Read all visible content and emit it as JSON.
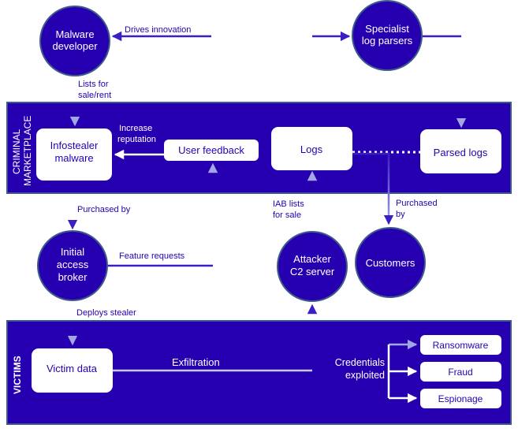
{
  "colors": {
    "primary": "#2600b0",
    "border": "#3f5a8a",
    "arrow_dark": "#3a1fc4",
    "arrow_light": "#a3a6e6",
    "box_fill": "#ffffff"
  },
  "regions": {
    "marketplace": {
      "label_line1": "CRIMINAL",
      "label_line2": "MARKETPLACE"
    },
    "victims": {
      "label": "VICTIMS"
    }
  },
  "actors": {
    "malware_developer": {
      "line1": "Malware",
      "line2": "developer"
    },
    "specialist_log_parsers": {
      "line1": "Specialist",
      "line2": "log parsers"
    },
    "initial_access_broker": {
      "line1": "Initial",
      "line2": "access",
      "line3": "broker"
    },
    "attacker_c2_server": {
      "line1": "Attacker",
      "line2": "C2 server"
    },
    "customers": {
      "label": "Customers"
    }
  },
  "boxes": {
    "infostealer_malware": {
      "line1": "Infostealer",
      "line2": "malware"
    },
    "user_feedback": {
      "label": "User feedback"
    },
    "logs": {
      "label": "Logs"
    },
    "parsed_logs": {
      "label": "Parsed logs"
    },
    "victim_data": {
      "label": "Victim data"
    },
    "outcomes": [
      {
        "label": "Ransomware"
      },
      {
        "label": "Fraud"
      },
      {
        "label": "Espionage"
      }
    ]
  },
  "edges": {
    "drives_innovation": "Drives innovation",
    "lists_for_sale_rent": {
      "line1": "Lists for",
      "line2": "sale/rent"
    },
    "increase_reputation": {
      "line1": "Increase",
      "line2": "reputation"
    },
    "purchased_by_iab": "Purchased by",
    "feature_requests": "Feature requests",
    "deploys_stealer": "Deploys stealer",
    "exfiltration": "Exfiltration",
    "iab_lists_for_sale": {
      "line1": "IAB lists",
      "line2": "for sale"
    },
    "purchased_by_customers": {
      "line1": "Purchased",
      "line2": "by"
    },
    "credentials_exploited": {
      "line1": "Credentials",
      "line2": "exploited"
    }
  }
}
